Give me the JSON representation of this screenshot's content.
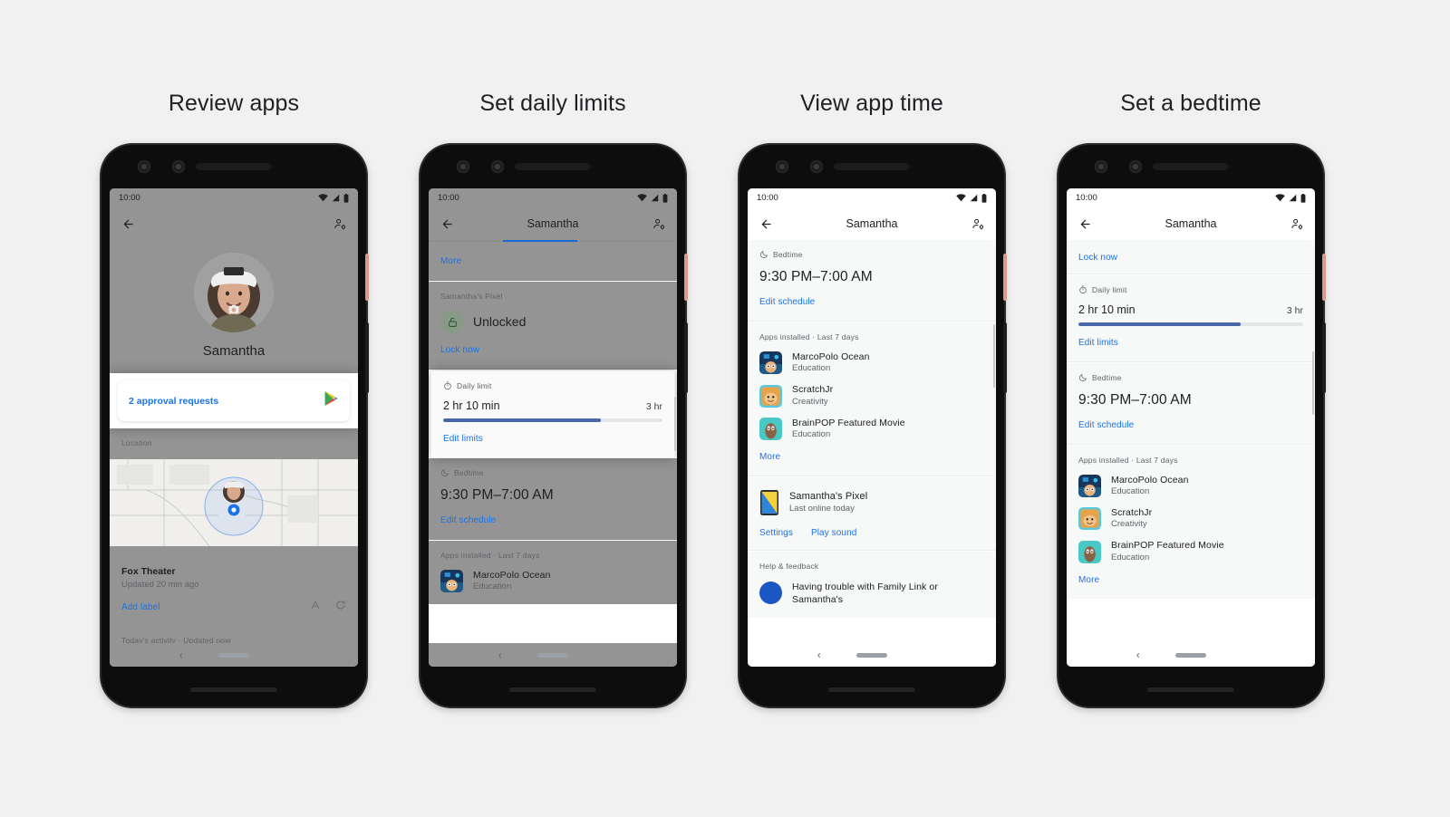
{
  "panels": [
    {
      "title": "Review apps",
      "status": {
        "time": "10:00",
        "wifi": "wifi-icon",
        "signal": "cell-signal-icon",
        "battery": "battery-icon"
      },
      "appbar": {
        "back": "back-arrow-icon",
        "title": "",
        "action": "manage-people-icon"
      },
      "profile": {
        "name": "Samantha",
        "camera_badge": "camera-icon"
      },
      "approval": {
        "label": "2 approval requests",
        "icon": "google-play-icon"
      },
      "location": {
        "section_label": "Location",
        "place": "Fox Theater",
        "updated": "Updated 20 min ago",
        "add_label": "Add label",
        "icon_a": "label-a-icon",
        "icon_refresh": "refresh-icon"
      },
      "activity_label": "Today's activity · Updated now",
      "nav": {
        "back": "nav-back-icon",
        "home": "nav-home-pill"
      }
    },
    {
      "title": "Set daily limits",
      "status": {
        "time": "10:00"
      },
      "appbar": {
        "title": "Samantha"
      },
      "more_link": "More",
      "device": {
        "section_label": "Samantha's Pixel",
        "state": "Unlocked",
        "state_icon": "unlocked-padlock-icon",
        "lock_now": "Lock now"
      },
      "daily_limit": {
        "section_label": "Daily limit",
        "icon": "timer-icon",
        "used": "2 hr 10 min",
        "max": "3 hr",
        "percent": 72,
        "edit": "Edit limits"
      },
      "bedtime": {
        "section_label": "Bedtime",
        "icon": "moon-icon",
        "range": "9:30 PM–7:00 AM",
        "edit": "Edit schedule"
      },
      "apps": {
        "section_label": "Apps installed · Last 7 days",
        "items": [
          {
            "name": "MarcoPolo Ocean",
            "category": "Education",
            "icon": "marcopolo-ocean-app-icon"
          }
        ]
      }
    },
    {
      "title": "View app time",
      "status": {
        "time": "10:00"
      },
      "appbar": {
        "title": "Samantha"
      },
      "bedtime": {
        "section_label": "Bedtime",
        "icon": "moon-icon",
        "range": "9:30 PM–7:00 AM",
        "edit": "Edit schedule"
      },
      "apps": {
        "section_label": "Apps installed · Last 7 days",
        "items": [
          {
            "name": "MarcoPolo Ocean",
            "category": "Education",
            "icon": "marcopolo-ocean-app-icon"
          },
          {
            "name": "ScratchJr",
            "category": "Creativity",
            "icon": "scratchjr-app-icon"
          },
          {
            "name": "BrainPOP Featured Movie",
            "category": "Education",
            "icon": "brainpop-app-icon"
          }
        ],
        "more": "More"
      },
      "device": {
        "name": "Samantha's Pixel",
        "sub": "Last online today",
        "icon": "phone-device-icon",
        "settings": "Settings",
        "play_sound": "Play sound"
      },
      "help": {
        "section_label": "Help & feedback",
        "text": "Having trouble with Family Link or Samantha's"
      }
    },
    {
      "title": "Set a bedtime",
      "status": {
        "time": "10:00"
      },
      "appbar": {
        "title": "Samantha"
      },
      "lock_now": "Lock now",
      "daily_limit": {
        "section_label": "Daily limit",
        "icon": "timer-icon",
        "used": "2 hr 10 min",
        "max": "3 hr",
        "percent": 72,
        "edit": "Edit limits"
      },
      "bedtime": {
        "section_label": "Bedtime",
        "icon": "moon-icon",
        "range": "9:30 PM–7:00 AM",
        "edit": "Edit schedule"
      },
      "apps": {
        "section_label": "Apps installed · Last 7 days",
        "items": [
          {
            "name": "MarcoPolo Ocean",
            "category": "Education",
            "icon": "marcopolo-ocean-app-icon"
          },
          {
            "name": "ScratchJr",
            "category": "Creativity",
            "icon": "scratchjr-app-icon"
          },
          {
            "name": "BrainPOP Featured Movie",
            "category": "Education",
            "icon": "brainpop-app-icon"
          }
        ],
        "more": "More"
      }
    }
  ],
  "colors": {
    "background": "#f1f1f1",
    "link": "#1a73e8",
    "progress": "#4868a8",
    "progress_track": "#e3e5e6",
    "card": "#f7f8f8",
    "text_primary": "#202124",
    "text_secondary": "#5f6368",
    "power_button": "#d79a8d"
  }
}
